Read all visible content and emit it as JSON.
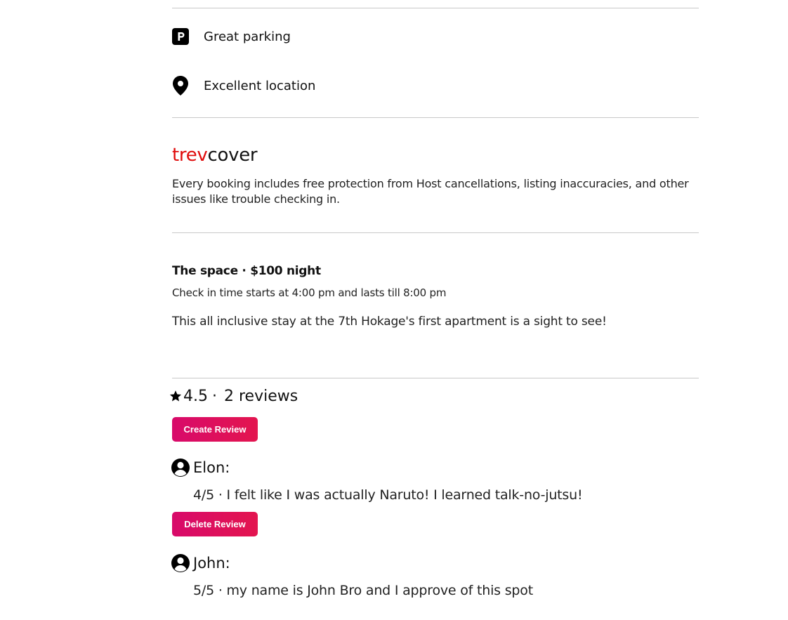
{
  "amenities": [
    {
      "icon": "parking-icon",
      "label": "Great parking"
    },
    {
      "icon": "location-pin-icon",
      "label": "Excellent location"
    }
  ],
  "cover": {
    "logo_part1": "trev",
    "logo_part2": "cover",
    "description": "Every booking includes free protection from Host cancellations, listing inaccuracies, and other issues like trouble checking in."
  },
  "space": {
    "title": "The space · $100 night",
    "checkin": "Check in time starts at 4:00 pm and lasts till 8:00 pm",
    "description": "This all inclusive stay at the 7th Hokage's first apartment is a sight to see!"
  },
  "reviews_summary": {
    "rating": "4.5",
    "separator": "·",
    "count_label": "2 reviews",
    "create_button": "Create Review"
  },
  "reviews": [
    {
      "name": "Elon:",
      "text": "4/5 · I felt like I was actually Naruto! I learned talk-no-jutsu!",
      "delete_button": "Delete Review"
    },
    {
      "name": "John:",
      "text": "5/5 · my name is John Bro and I approve of this spot"
    }
  ],
  "colors": {
    "brand_red": "#e00b0b",
    "button_gradient_start": "#d80a6a",
    "button_gradient_end": "#e3154f",
    "divider": "#c8c8c8"
  }
}
